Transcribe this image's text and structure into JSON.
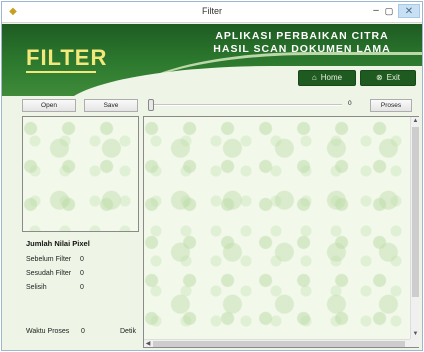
{
  "window": {
    "title": "Filter",
    "icon": "app-icon",
    "min_glyph": "–",
    "max_glyph": "▢",
    "close_glyph": "✕"
  },
  "banner": {
    "logo": "FILTER",
    "headline_line1": "APLIKASI PERBAIKAN CITRA",
    "headline_line2": "HASIL SCAN DOKUMEN LAMA",
    "home_label": "Home",
    "home_icon": "home-icon",
    "exit_label": "Exit",
    "exit_icon": "exit-icon",
    "colors": {
      "dark_green": "#1e5c22",
      "logo_yellow": "#f3e97a"
    }
  },
  "toolbar": {
    "open_label": "Open",
    "save_label": "Save",
    "slider_value": "0",
    "proses_label": "Proses"
  },
  "stats": {
    "title": "Jumlah Nilai Pixel",
    "rows": [
      {
        "label": "Sebelum Filter",
        "value": "0"
      },
      {
        "label": "Sesudah Filter",
        "value": "0"
      },
      {
        "label": "Selisih",
        "value": "0"
      }
    ],
    "time_label": "Waktu Proses",
    "time_value": "0",
    "time_unit": "Detik"
  }
}
